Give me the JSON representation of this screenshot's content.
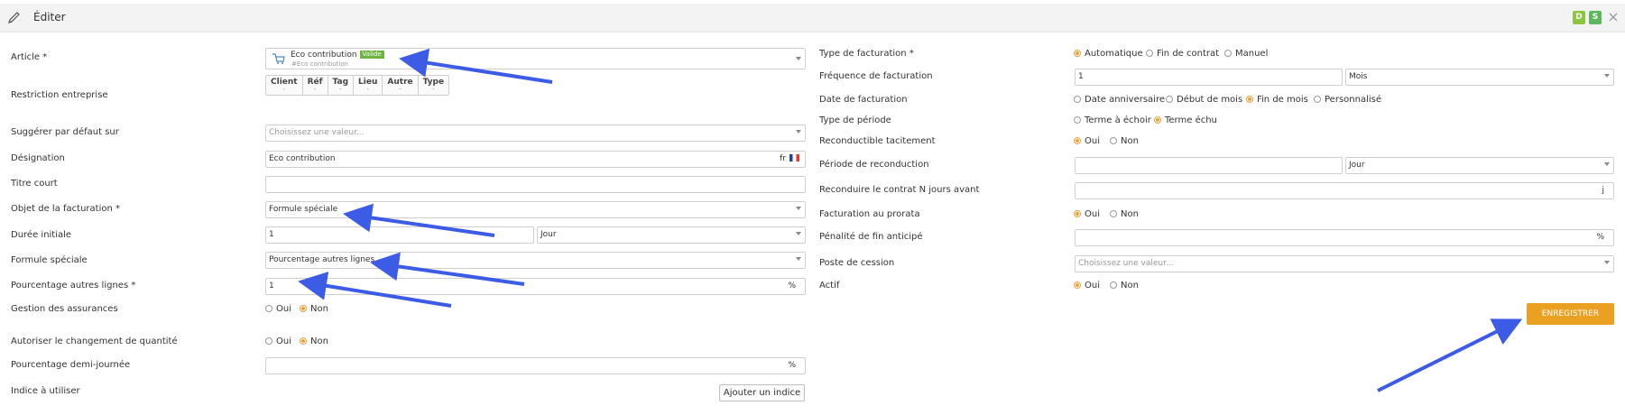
{
  "header": {
    "title": "Éditer",
    "badge_d": "D",
    "badge_s": "S",
    "colors": {
      "badge_d": "#8cc63f",
      "badge_s": "#5cb85c"
    }
  },
  "left": {
    "article": {
      "label": "Article *",
      "value": "Eco contribution",
      "status": "Valide",
      "sub": "#Eco contribution"
    },
    "restriction": {
      "label": "Restriction entreprise",
      "tabs": [
        "Client",
        "Réf",
        "Tag",
        "Lieu",
        "Autre",
        "Type"
      ],
      "tab_sub": "-"
    },
    "suggerer": {
      "label": "Suggérer par défaut sur",
      "placeholder": "Choisissez une valeur..."
    },
    "designation": {
      "label": "Désignation",
      "value": "Eco contribution",
      "lang": "fr"
    },
    "titre_court": {
      "label": "Titre court",
      "value": ""
    },
    "objet": {
      "label": "Objet de la facturation *",
      "value": "Formule spéciale"
    },
    "duree": {
      "label": "Durée initiale",
      "value": "1",
      "unit": "Jour"
    },
    "formule": {
      "label": "Formule spéciale",
      "value": "Pourcentage autres lignes"
    },
    "pourcentage": {
      "label": "Pourcentage autres lignes *",
      "value": "1",
      "suffix": "%"
    },
    "assurances": {
      "label": "Gestion des assurances",
      "options": [
        "Oui",
        "Non"
      ],
      "selected": "Non"
    },
    "changement": {
      "label": "Autoriser le changement de quantité",
      "options": [
        "Oui",
        "Non"
      ],
      "selected": "Non"
    },
    "demi_journee": {
      "label": "Pourcentage demi-journée",
      "value": "",
      "suffix": "%"
    },
    "indice": {
      "label": "Indice à utiliser",
      "button": "Ajouter un indice"
    }
  },
  "right": {
    "type_facturation": {
      "label": "Type de facturation *",
      "options": [
        "Automatique",
        "Fin de contrat",
        "Manuel"
      ],
      "selected": "Automatique"
    },
    "frequence": {
      "label": "Fréquence de facturation",
      "value": "1",
      "unit": "Mois"
    },
    "date_facturation": {
      "label": "Date de facturation",
      "options": [
        "Date anniversaire",
        "Début de mois",
        "Fin de mois",
        "Personnalisé"
      ],
      "selected": "Fin de mois"
    },
    "type_periode": {
      "label": "Type de période",
      "options": [
        "Terme à échoir",
        "Terme échu"
      ],
      "selected": "Terme échu"
    },
    "reconductible": {
      "label": "Reconductible tacitement",
      "options": [
        "Oui",
        "Non"
      ],
      "selected": "Oui"
    },
    "periode_reconduction": {
      "label": "Période de reconduction",
      "value": "",
      "unit": "Jour"
    },
    "reconduire": {
      "label": "Reconduire le contrat N jours avant",
      "value": "",
      "suffix": "j"
    },
    "prorata": {
      "label": "Facturation au prorata",
      "options": [
        "Oui",
        "Non"
      ],
      "selected": "Oui"
    },
    "penalite": {
      "label": "Pénalité de fin anticipé",
      "value": "",
      "suffix": "%"
    },
    "poste_cession": {
      "label": "Poste de cession",
      "placeholder": "Choisissez une valeur..."
    },
    "actif": {
      "label": "Actif",
      "options": [
        "Oui",
        "Non"
      ],
      "selected": "Oui"
    }
  },
  "actions": {
    "save": "ENREGISTRER",
    "save_color": "#eaa122"
  },
  "annotations": {
    "arrow_color": "#3d5ce6"
  }
}
